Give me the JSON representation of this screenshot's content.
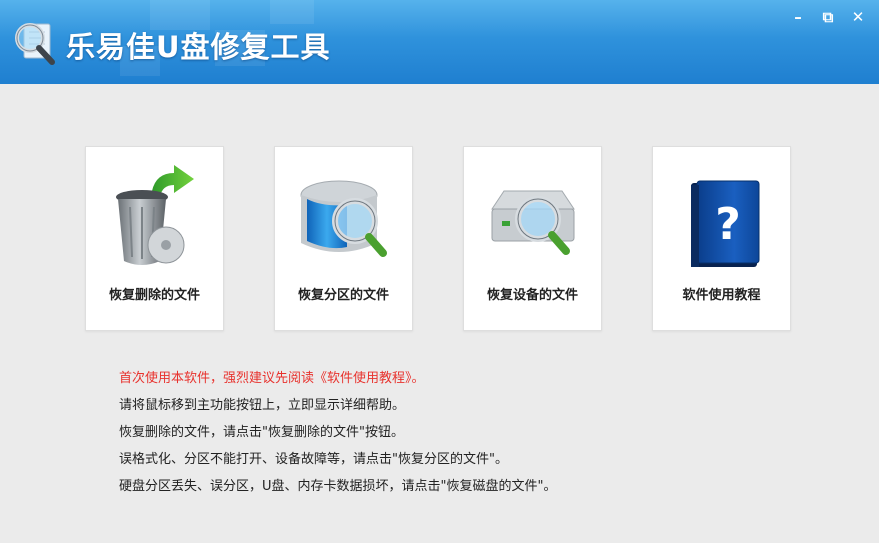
{
  "window": {
    "title": "乐易佳U盘修复工具",
    "controls": {
      "minimize": "–",
      "restore": "⧉",
      "close": "✕"
    }
  },
  "colors": {
    "titlebar": "#2f92dc",
    "background": "#ebebeb",
    "warning_text": "#e8322d",
    "card": "#ffffff"
  },
  "cards": [
    {
      "label": "恢复删除的文件",
      "icon": "recycle-bin-icon"
    },
    {
      "label": "恢复分区的文件",
      "icon": "disk-search-icon"
    },
    {
      "label": "恢复设备的文件",
      "icon": "device-search-icon"
    },
    {
      "label": "软件使用教程",
      "icon": "help-book-icon"
    }
  ],
  "notes": [
    "首次使用本软件，强烈建议先阅读《软件使用教程》。",
    "请将鼠标移到主功能按钮上，立即显示详细帮助。",
    "恢复删除的文件，请点击\"恢复删除的文件\"按钮。",
    "误格式化、分区不能打开、设备故障等，请点击\"恢复分区的文件\"。",
    "硬盘分区丢失、误分区，U盘、内存卡数据损坏，请点击\"恢复磁盘的文件\"。"
  ]
}
